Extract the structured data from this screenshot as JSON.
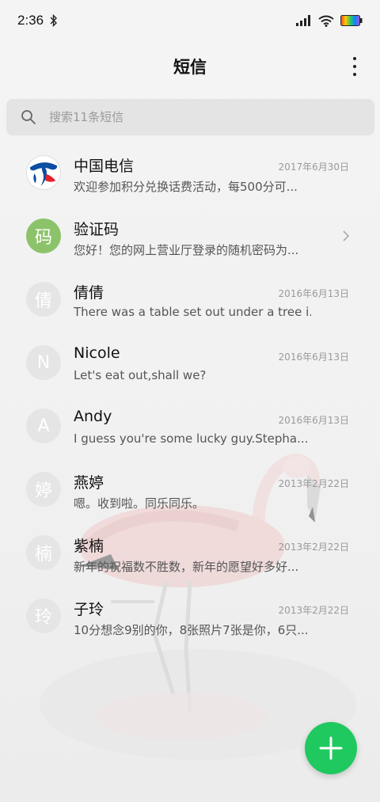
{
  "status_bar": {
    "time": "2:36",
    "icons": [
      "bluetooth-icon",
      "signal-icon",
      "wifi-icon",
      "battery-icon"
    ]
  },
  "header": {
    "title": "短信",
    "more_icon": "more-vertical-icon"
  },
  "search": {
    "placeholder": "搜索11条短信",
    "icon": "search-icon"
  },
  "messages": [
    {
      "name": "中国电信",
      "preview": "欢迎参加积分兑换话费活动，每500分可...",
      "date": "2017年6月30日",
      "avatar": "",
      "avatar_type": "telecom-logo"
    },
    {
      "name": "验证码",
      "preview": "您好！您的网上营业厅登录的随机密码为...",
      "date": "",
      "avatar": "码",
      "avatar_type": "green"
    },
    {
      "name": "倩倩",
      "preview": "There was a table set out under a tree i...",
      "date": "2016年6月13日",
      "avatar": "倩",
      "avatar_type": "letter"
    },
    {
      "name": "Nicole",
      "preview": "Let's eat out,shall we?",
      "date": "2016年6月13日",
      "avatar": "N",
      "avatar_type": "letter"
    },
    {
      "name": "Andy",
      "preview": "I guess you're some lucky guy.Stepha...",
      "date": "2016年6月13日",
      "avatar": "A",
      "avatar_type": "letter"
    },
    {
      "name": "燕婷",
      "preview": "嗯。收到啦。同乐同乐。",
      "date": "2013年2月22日",
      "avatar": "婷",
      "avatar_type": "letter"
    },
    {
      "name": "紫楠",
      "preview": "新年的祝福数不胜数，新年的愿望好多好...",
      "date": "2013年2月22日",
      "avatar": "楠",
      "avatar_type": "letter"
    },
    {
      "name": "子玲",
      "preview": "10分想念9别的你，8张照片7张是你，6只...",
      "date": "2013年2月22日",
      "avatar": "玲",
      "avatar_type": "letter"
    }
  ],
  "fab": {
    "icon": "plus-icon",
    "color": "#1fc95f"
  },
  "colors": {
    "accent": "#1fc95f",
    "avatar_green": "#8cc36a",
    "telecom_blue": "#0b4ea2"
  }
}
